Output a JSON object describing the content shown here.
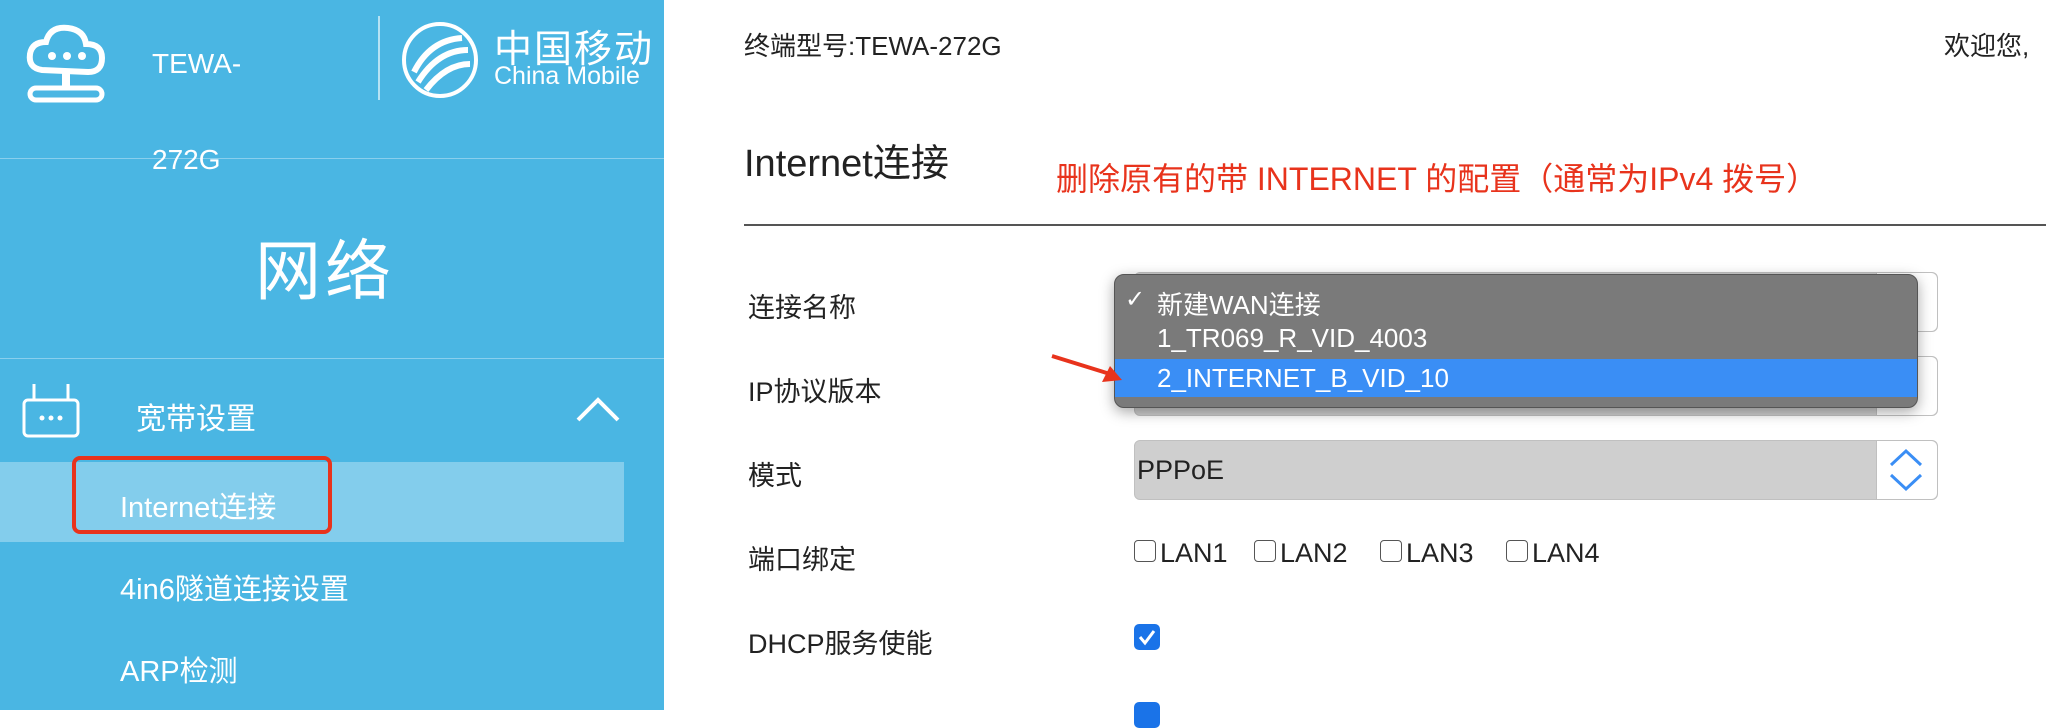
{
  "sidebar": {
    "model_line1": "TEWA-",
    "model_line2": "272G",
    "brand_cn": "中国移动",
    "brand_en": "China Mobile",
    "section_title": "网络",
    "group_label": "宽带设置",
    "items": [
      {
        "label": "Internet连接"
      },
      {
        "label": "4in6隧道连接设置"
      },
      {
        "label": "ARP检测"
      }
    ]
  },
  "header": {
    "device_model": "终端型号:TEWA-272G",
    "welcome": "欢迎您,"
  },
  "page": {
    "title": "Internet连接",
    "annotation": "删除原有的带 INTERNET 的配置（通常为IPv4 拨号）"
  },
  "form": {
    "connection_name_label": "连接名称",
    "ip_version_label": "IP协议版本",
    "mode_label": "模式",
    "mode_value": "PPPoE",
    "port_binding_label": "端口绑定",
    "ports": [
      {
        "label": "LAN1",
        "checked": false
      },
      {
        "label": "LAN2",
        "checked": false
      },
      {
        "label": "LAN3",
        "checked": false
      },
      {
        "label": "LAN4",
        "checked": false
      }
    ],
    "dhcp_label": "DHCP服务使能",
    "dhcp_checked": true
  },
  "dropdown": {
    "options": [
      {
        "label": "新建WAN连接",
        "checked": true
      },
      {
        "label": "1_TR069_R_VID_4003",
        "checked": false
      },
      {
        "label": "2_INTERNET_B_VID_10",
        "highlighted": true
      }
    ]
  },
  "colors": {
    "sidebar_bg": "#4ab6e3",
    "annotation_red": "#e8331c",
    "highlight_blue": "#3a8ef5"
  },
  "icons": {
    "logo": "cloud-router-icon",
    "brand": "china-mobile-logo-icon",
    "group": "router-icon",
    "collapse": "chevron-up-icon"
  }
}
